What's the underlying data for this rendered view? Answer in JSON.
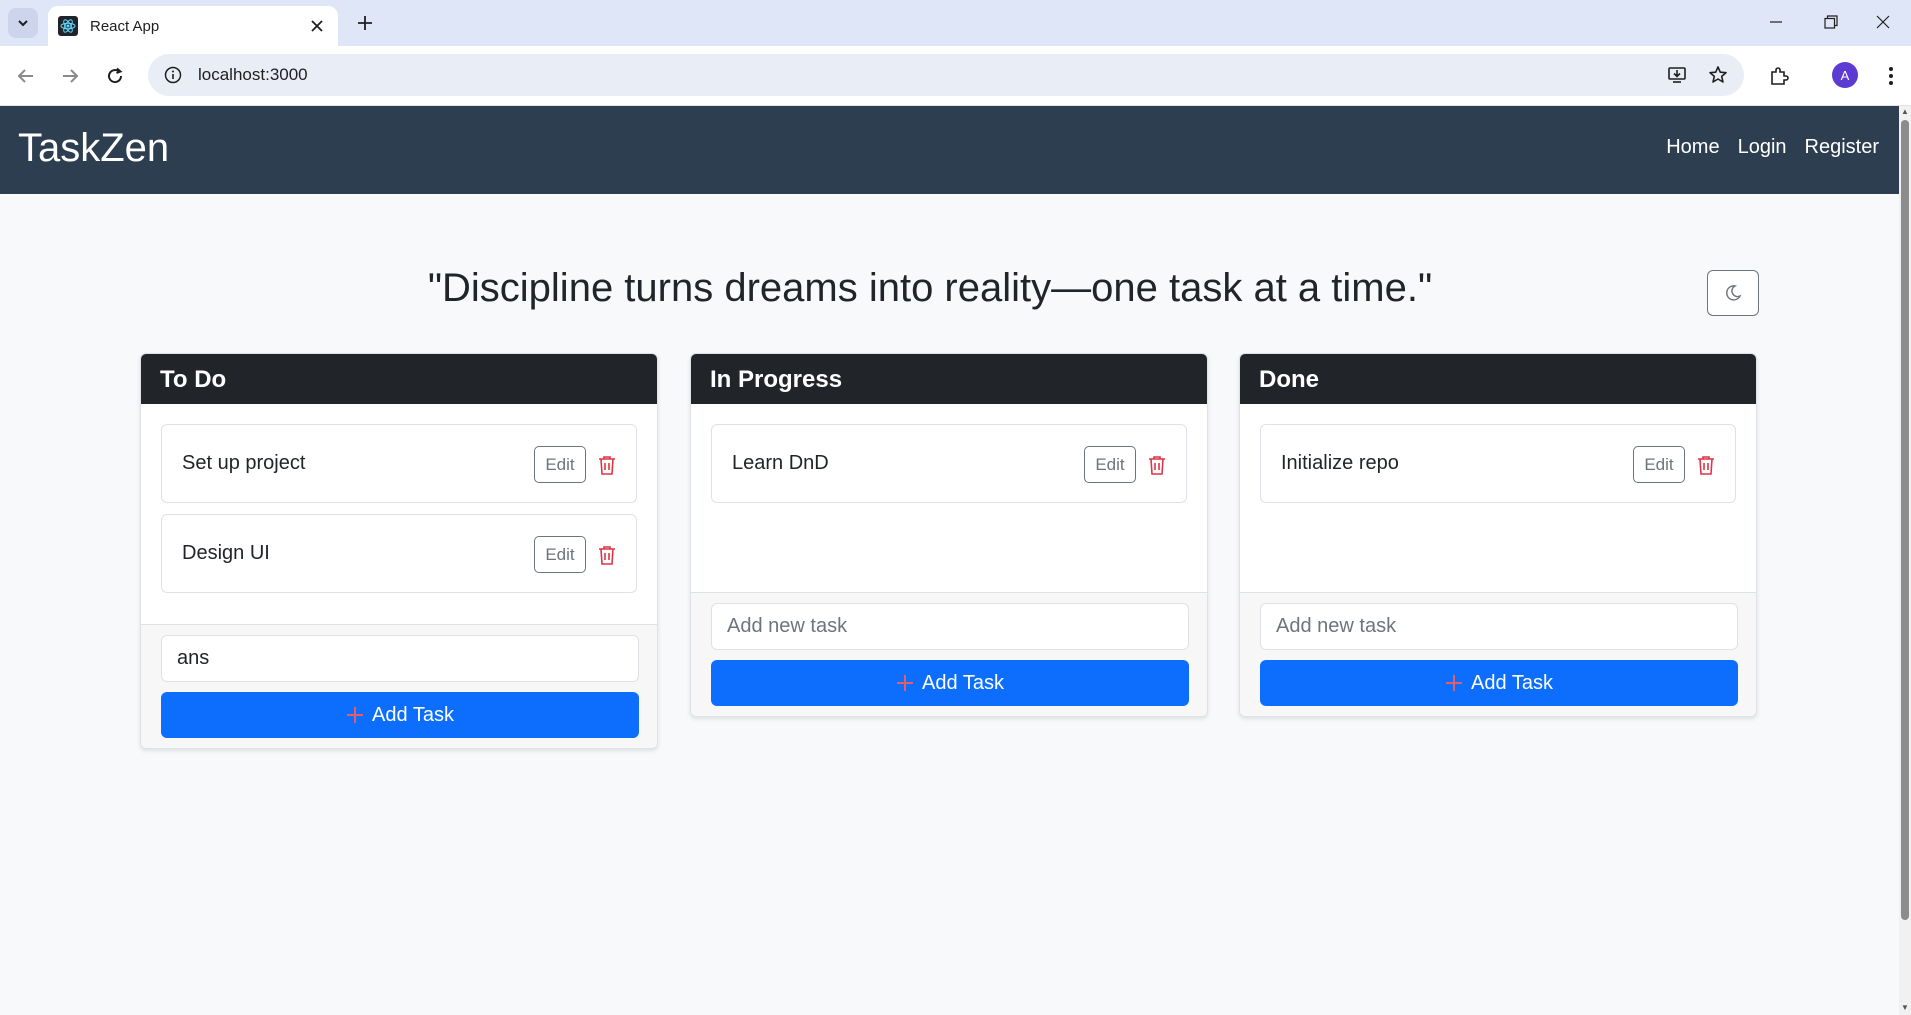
{
  "browser": {
    "tab_title": "React App",
    "url": "localhost:3000",
    "profile_initial": "A"
  },
  "navbar": {
    "brand": "TaskZen",
    "links": [
      "Home",
      "Login",
      "Register"
    ]
  },
  "quote": "\"Discipline turns dreams into reality—one task at a time.\"",
  "columns": [
    {
      "title": "To Do",
      "tasks": [
        "Set up project",
        "Design UI"
      ],
      "input_value": "ans",
      "input_placeholder": "Add new task",
      "add_label": "Add Task"
    },
    {
      "title": "In Progress",
      "tasks": [
        "Learn DnD"
      ],
      "input_value": "",
      "input_placeholder": "Add new task",
      "add_label": "Add Task"
    },
    {
      "title": "Done",
      "tasks": [
        "Initialize repo"
      ],
      "input_value": "",
      "input_placeholder": "Add new task",
      "add_label": "Add Task"
    }
  ],
  "task_edit_label": "Edit",
  "colors": {
    "navbar_bg": "#2c3e50",
    "column_header_bg": "#212529",
    "primary": "#0d6efd",
    "danger": "#dc3545",
    "plus_icon": "#e35d6a"
  }
}
